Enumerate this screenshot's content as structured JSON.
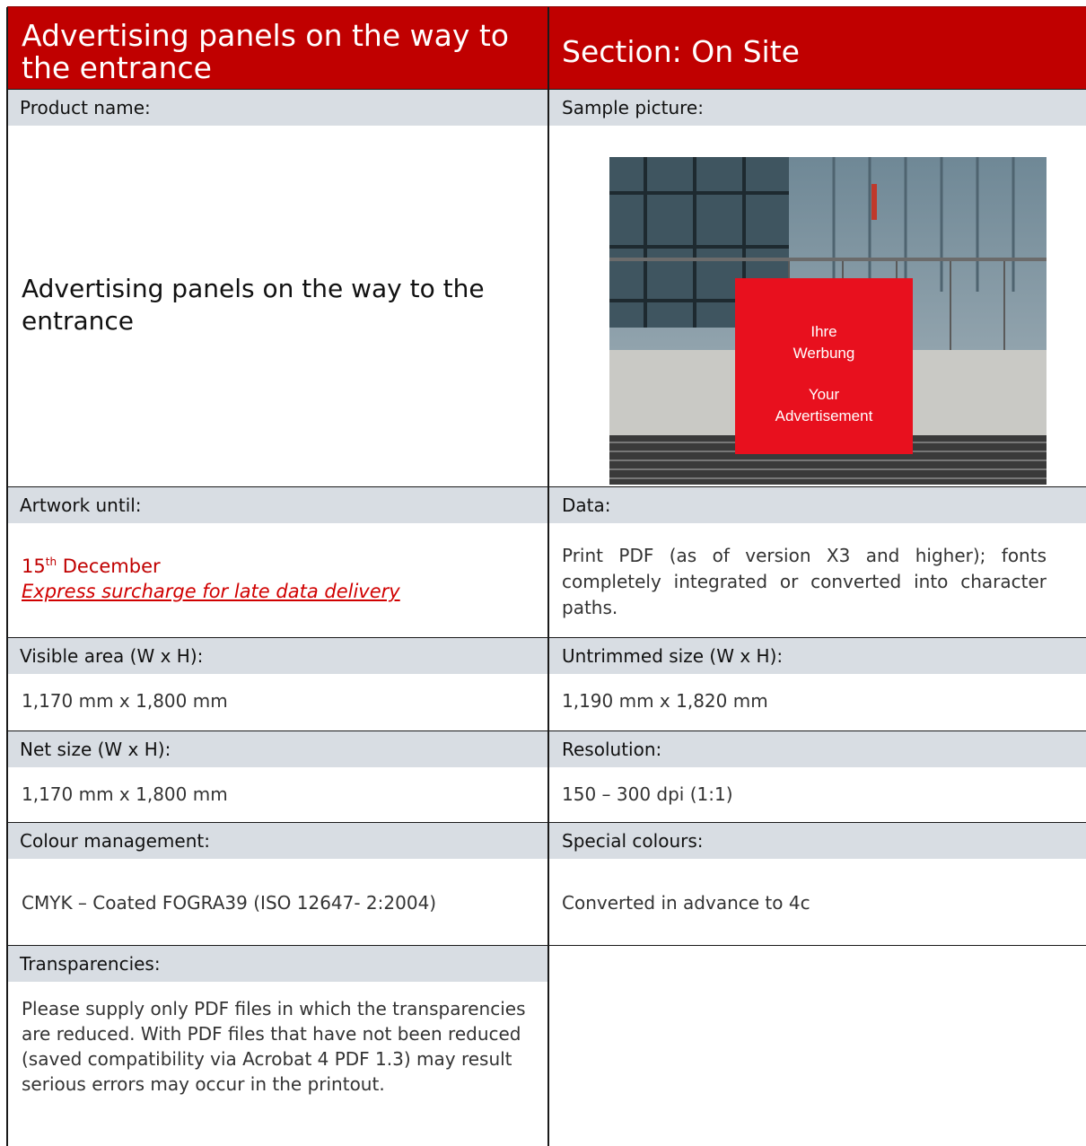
{
  "header": {
    "title": "Advertising panels on the way to the entrance",
    "section": "Section: On Site"
  },
  "labels": {
    "product_name": "Product name:",
    "sample_picture": "Sample picture:",
    "artwork_until": "Artwork until:",
    "data": "Data:",
    "visible_area": "Visible area (W x H):",
    "untrimmed_size": "Untrimmed size (W x H):",
    "net_size": "Net size (W x H):",
    "resolution": "Resolution:",
    "colour_management": "Colour management:",
    "special_colours": "Special colours:",
    "transparencies": "Transparencies:"
  },
  "values": {
    "product_name": "Advertising panels on the way to the entrance",
    "artwork_day": "15",
    "artwork_day_suffix": "th",
    "artwork_month": " December",
    "express_link": "Express surcharge for late data delivery",
    "data": "Print PDF (as of version X3 and higher); fonts completely integrated or converted into character paths.",
    "visible_area": "1,170 mm x 1,800 mm",
    "untrimmed_size": "1,190 mm x 1,820 mm",
    "net_size": "1,170 mm x 1,800 mm",
    "resolution": "150 – 300 dpi (1:1)",
    "colour_management": "CMYK – Coated FOGRA39 (ISO 12647- 2:2004)",
    "special_colours": "Converted in advance to 4c",
    "transparencies": "Please supply only PDF files in which the transparencies are reduced. With PDF files that have not been reduced (saved compatibility via Acrobat 4 PDF 1.3) may result serious errors may occur in the printout."
  },
  "sample_image": {
    "sign_line1": "Ihre",
    "sign_line2": "Werbung",
    "sign_line3": "Your",
    "sign_line4": "Advertisement",
    "sign_color": "#e8101e"
  },
  "colors": {
    "header_bg": "#c00000",
    "label_bg": "#d8dde3",
    "accent_red": "#c00000"
  }
}
